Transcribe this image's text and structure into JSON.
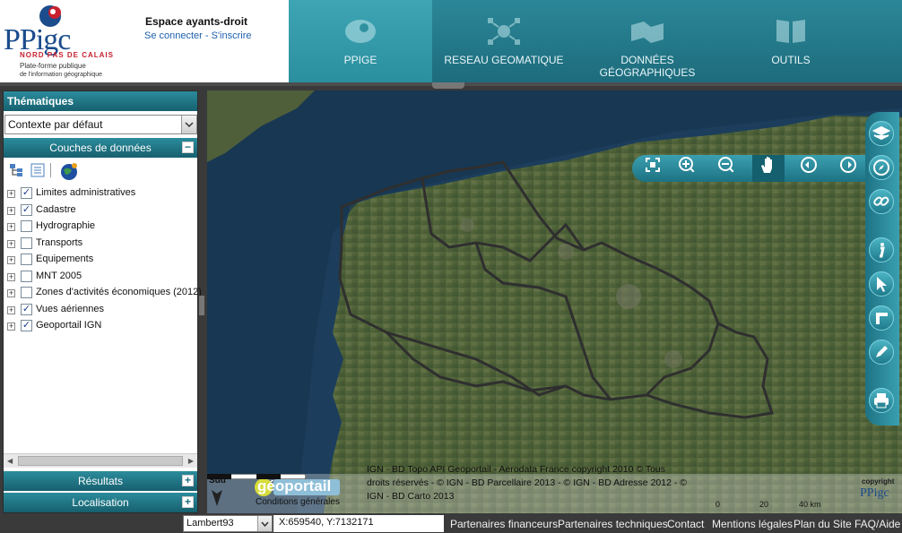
{
  "header": {
    "logo_text": "PPigc",
    "logo_region": "NORD PAS DE CALAIS",
    "logo_tagline1": "Plate-forme publique",
    "logo_tagline2": "de l'information géographique",
    "account_title": "Espace ayants-droit",
    "account_links": "Se connecter - S'inscrire",
    "nav": [
      {
        "label": "PPIGE",
        "icon": "eye-icon",
        "active": true
      },
      {
        "label": "RESEAU GEOMATIQUE",
        "icon": "network-icon",
        "active": false
      },
      {
        "label": "DONNÉES GÉOGRAPHIQUES",
        "icon": "map-data-icon",
        "active": false
      },
      {
        "label": "OUTILS",
        "icon": "book-icon",
        "active": false
      }
    ],
    "accent_color": "#2b8797"
  },
  "left_panel": {
    "thematiques_title": "Thématiques",
    "context_selected": "Contexte par défaut",
    "couches_title": "Couches de données",
    "toolbar_icons": [
      "layer-tree-icon",
      "layer-list-icon",
      "add-layer-globe-icon"
    ],
    "layers": [
      {
        "label": "Limites administratives",
        "checked": true
      },
      {
        "label": "Cadastre",
        "checked": true
      },
      {
        "label": "Hydrographie",
        "checked": false
      },
      {
        "label": "Transports",
        "checked": false
      },
      {
        "label": "Equipements",
        "checked": false
      },
      {
        "label": "MNT 2005",
        "checked": false
      },
      {
        "label": "Zones d'activités économiques (2012)",
        "checked": false
      },
      {
        "label": "Vues aériennes",
        "checked": true
      },
      {
        "label": "Geoportail IGN",
        "checked": true
      }
    ],
    "resultats_title": "Résultats",
    "localisation_title": "Localisation"
  },
  "map": {
    "toolbar_icons": [
      "zoom-extent-icon",
      "zoom-in-icon",
      "zoom-out-icon",
      "pan-hand-icon",
      "previous-view-icon",
      "next-view-icon"
    ],
    "right_toolbar_icons": [
      "layers-stack-icon",
      "compass-icon",
      "link-icon",
      "info-icon",
      "select-cursor-icon",
      "measure-icon",
      "draw-pen-icon",
      "print-icon"
    ],
    "orientation_label": "Sud",
    "geoportail_logo": "géoportail",
    "geoportail_conditions": "Conditions générales",
    "attribution": "IGN - BD Topo API Geoportail - Aerodata France copyright 2010 © Tous droits réservés - © IGN - BD Parcellaire 2013 - © IGN - BD Adresse 2012 - © IGN - BD Carto 2013",
    "scale_labels": [
      "0",
      "20",
      "40 km"
    ],
    "copyright_label": "copyright",
    "copyright_logo": "PPigc"
  },
  "footer": {
    "projection": "Lambert93",
    "coordinates": "X:659540, Y:7132171",
    "links": [
      "Partenaires financeurs",
      "Partenaires techniques",
      "Contact",
      "Mentions légales",
      "Plan du Site",
      "FAQ/Aide"
    ]
  }
}
